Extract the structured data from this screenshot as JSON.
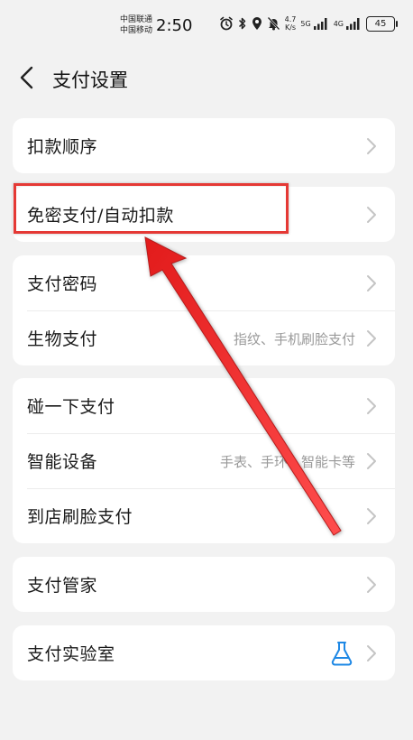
{
  "status_bar": {
    "carrier_1": "中国联通",
    "carrier_2": "中国移动",
    "time": "2:50",
    "net_speed_value": "4.7",
    "net_speed_unit": "K/s",
    "network_1": "5G",
    "network_2": "4G",
    "battery": "45"
  },
  "header": {
    "title": "支付设置"
  },
  "groups": [
    {
      "items": [
        {
          "label": "扣款顺序",
          "value": ""
        }
      ]
    },
    {
      "items": [
        {
          "label": "免密支付/自动扣款",
          "value": ""
        }
      ]
    },
    {
      "items": [
        {
          "label": "支付密码",
          "value": ""
        },
        {
          "label": "生物支付",
          "value": "指纹、手机刷脸支付"
        }
      ]
    },
    {
      "items": [
        {
          "label": "碰一下支付",
          "value": ""
        },
        {
          "label": "智能设备",
          "value": "手表、手环、智能卡等"
        },
        {
          "label": "到店刷脸支付",
          "value": ""
        }
      ]
    },
    {
      "items": [
        {
          "label": "支付管家",
          "value": ""
        }
      ]
    },
    {
      "items": [
        {
          "label": "支付实验室",
          "value": "",
          "icon": "flask-icon"
        }
      ]
    }
  ],
  "colors": {
    "background": "#f2f2f2",
    "card": "#ffffff",
    "annotation_red": "#e53935",
    "flask_blue": "#1e88e5",
    "chevron": "#c4c4c4"
  }
}
